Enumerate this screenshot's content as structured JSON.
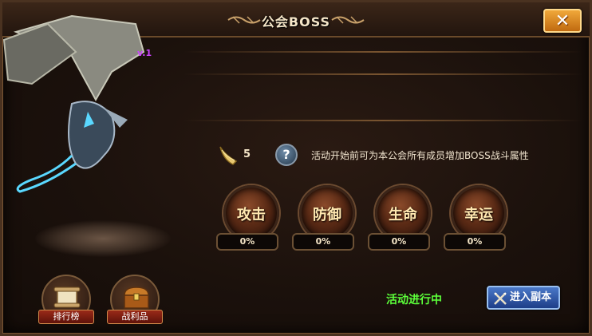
{
  "window": {
    "title": "公会BOSS",
    "close_label": "✕"
  },
  "boss": {
    "level_label": "v.1"
  },
  "tokens": {
    "count": "5",
    "description": "活动开始前可为本公会所有成员增加BOSS战斗属性"
  },
  "help": {
    "glyph": "?"
  },
  "stats": [
    {
      "label": "攻击",
      "value": "0%"
    },
    {
      "label": "防御",
      "value": "0%"
    },
    {
      "label": "生命",
      "value": "0%"
    },
    {
      "label": "幸运",
      "value": "0%"
    }
  ],
  "bottom": {
    "ranking_label": "排行榜",
    "rewards_label": "战利品",
    "status": "活动进行中",
    "enter_label": "进入副本"
  },
  "colors": {
    "status_green": "#5cff3a",
    "title_cream": "#f5e6c8",
    "level_purple": "#cc44ff",
    "button_blue": "#2a58b0",
    "close_orange": "#e08a20"
  },
  "icons": [
    "horn-icon",
    "help-icon",
    "scroll-icon",
    "treasure-chest-icon",
    "swords-icon",
    "close-icon",
    "flourish-icon"
  ]
}
